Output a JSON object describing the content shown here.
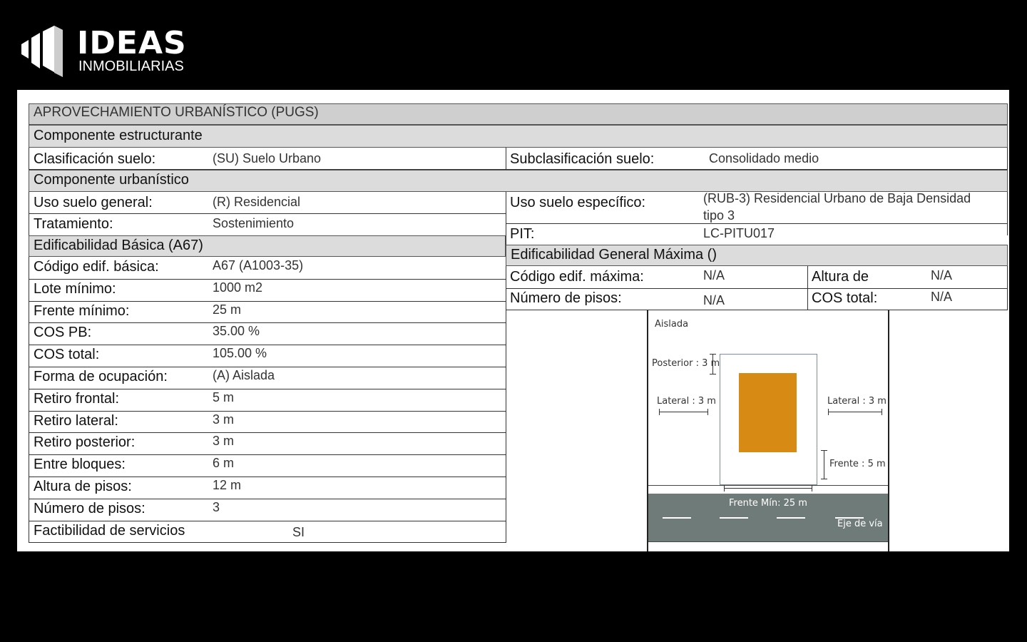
{
  "brand": {
    "name": "IDEAS",
    "tagline": "INMOBILIARIAS"
  },
  "header": {
    "title": "APROVECHAMIENTO URBANÍSTICO (PUGS)",
    "section_structural": "Componente  estructurante",
    "section_urban": "Componente  urbanístico"
  },
  "clasificacion": {
    "label": "Clasificación suelo:",
    "value": "(SU) Suelo Urbano",
    "sub_label": "Subclasificación suelo:",
    "sub_value": "Consolidado medio"
  },
  "uso": {
    "general_label": "Uso suelo general:",
    "general_value": "(R) Residencial",
    "especifico_label": "Uso suelo específico:",
    "especifico_value_1": "(RUB-3) Residencial Urbano de Baja Densidad",
    "especifico_value_2": "tipo 3",
    "tratamiento_label": "Tratamiento:",
    "tratamiento_value": "Sostenimiento",
    "pit_label": "PIT:",
    "pit_value": "LC-PITU017"
  },
  "basica": {
    "title": "Edificabilidad Básica (A67)",
    "rows": [
      {
        "label": "Código edif. básica:",
        "value": "A67 (A1003-35)"
      },
      {
        "label": "Lote mínimo:",
        "value": "1000 m2"
      },
      {
        "label": "Frente mínimo:",
        "value": "25 m"
      },
      {
        "label": "COS PB:",
        "value": "35.00 %"
      },
      {
        "label": "COS total:",
        "value": "105.00 %"
      },
      {
        "label": "Forma de ocupación:",
        "value": "(A) Aislada"
      },
      {
        "label": "Retiro frontal:",
        "value": "5 m"
      },
      {
        "label": "Retiro lateral:",
        "value": "3 m"
      },
      {
        "label": "Retiro posterior:",
        "value": "3 m"
      },
      {
        "label": "Entre bloques:",
        "value": "6 m"
      },
      {
        "label": "Altura de pisos:",
        "value": "12 m"
      },
      {
        "label": "Número de pisos:",
        "value": "3"
      },
      {
        "label": "Factibilidad de servicios",
        "value": "SI"
      }
    ]
  },
  "maxima": {
    "title": "Edificabilidad General Máxima ()",
    "codigo_label": "Código edif. máxima:",
    "codigo_value": "N/A",
    "altura_label": "Altura de",
    "altura_value": "N/A",
    "pisos_label": "Número de pisos:",
    "pisos_value": "N/A",
    "cos_label": "COS total:",
    "cos_value": "N/A"
  },
  "diagram": {
    "type_label": "Aislada",
    "posterior": "Posterior : 3 m",
    "lateral_left": "Lateral : 3 m",
    "lateral_right": "Lateral : 3 m",
    "frente": "Frente : 5 m",
    "frente_min": "Frente Mín: 25 m",
    "eje": "Eje de vía",
    "building_color": "#d78a14",
    "road_color": "#6f7b78"
  }
}
